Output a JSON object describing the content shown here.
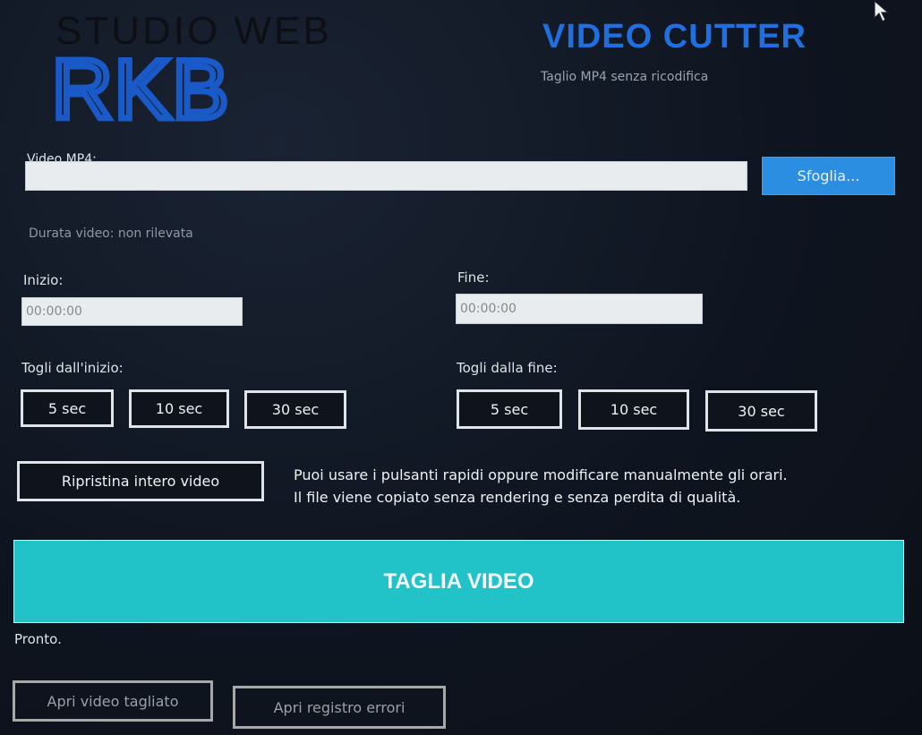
{
  "brand": {
    "studio": "STUDIO WEB",
    "logo": "RKB"
  },
  "app": {
    "title": "VIDEO CUTTER",
    "subtitle": "Taglio MP4 senza ricodifica"
  },
  "file": {
    "label": "Video MP4:",
    "value": "",
    "browse_label": "Sfoglia..."
  },
  "duration_text": "Durata video: non rilevata",
  "start": {
    "label": "Inizio:",
    "value": "00:00:00"
  },
  "end": {
    "label": "Fine:",
    "value": "00:00:00"
  },
  "trim_start": {
    "label": "Togli dall'inizio:",
    "buttons": [
      "5 sec",
      "10 sec",
      "30 sec"
    ]
  },
  "trim_end": {
    "label": "Togli dalla fine:",
    "buttons": [
      "5 sec",
      "10 sec",
      "30 sec"
    ]
  },
  "reset_label": "Ripristina intero video",
  "info_lines": [
    "Puoi usare i pulsanti rapidi oppure modificare manualmente gli orari.",
    "Il file viene copiato senza rendering e senza perdita di qualità."
  ],
  "cut_label": "TAGLIA VIDEO",
  "status": "Pronto.",
  "open_cut_label": "Apri video tagliato",
  "open_log_label": "Apri registro errori",
  "colors": {
    "accent_blue": "#1f6fe0",
    "button_blue": "#2b8ee0",
    "cut_teal": "#22c3c8"
  }
}
